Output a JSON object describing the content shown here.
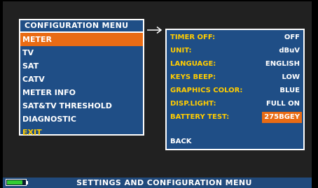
{
  "menu": {
    "title": "CONFIGURATION MENU",
    "items": [
      {
        "label": "METER"
      },
      {
        "label": "TV"
      },
      {
        "label": "SAT"
      },
      {
        "label": "CATV"
      },
      {
        "label": "METER INFO"
      },
      {
        "label": "SAT&TV THRESHOLD"
      },
      {
        "label": "DIAGNOSTIC"
      },
      {
        "label": "EXIT"
      }
    ],
    "selected_index": 0
  },
  "submenu": {
    "rows": [
      {
        "key": "TIMER OFF:",
        "value": "OFF"
      },
      {
        "key": "UNIT:",
        "value": "dBuV"
      },
      {
        "key": "LANGUAGE:",
        "value": "ENGLISH"
      },
      {
        "key": "KEYS BEEP:",
        "value": "LOW"
      },
      {
        "key": "GRAPHICS COLOR:",
        "value": "BLUE"
      },
      {
        "key": "DISP.LIGHT:",
        "value": "FULL ON"
      },
      {
        "key": "BATTERY TEST:",
        "value": "275BGEY"
      }
    ],
    "back_label": "BACK"
  },
  "status": {
    "text": "SETTINGS AND CONFIGURATION MENU",
    "battery_level": 0.85
  },
  "colors": {
    "panel_blue": "#1f4e86",
    "highlight_orange": "#e96b14",
    "key_yellow": "#ffcc00",
    "battery_green": "#33cc33"
  }
}
